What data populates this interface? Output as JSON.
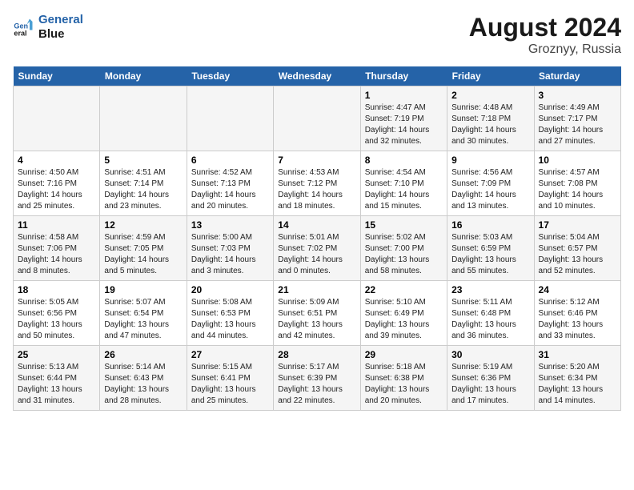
{
  "logo": {
    "line1": "General",
    "line2": "Blue"
  },
  "title": "August 2024",
  "subtitle": "Groznyy, Russia",
  "days_of_week": [
    "Sunday",
    "Monday",
    "Tuesday",
    "Wednesday",
    "Thursday",
    "Friday",
    "Saturday"
  ],
  "weeks": [
    [
      {
        "day": "",
        "info": ""
      },
      {
        "day": "",
        "info": ""
      },
      {
        "day": "",
        "info": ""
      },
      {
        "day": "",
        "info": ""
      },
      {
        "day": "1",
        "info": "Sunrise: 4:47 AM\nSunset: 7:19 PM\nDaylight: 14 hours\nand 32 minutes."
      },
      {
        "day": "2",
        "info": "Sunrise: 4:48 AM\nSunset: 7:18 PM\nDaylight: 14 hours\nand 30 minutes."
      },
      {
        "day": "3",
        "info": "Sunrise: 4:49 AM\nSunset: 7:17 PM\nDaylight: 14 hours\nand 27 minutes."
      }
    ],
    [
      {
        "day": "4",
        "info": "Sunrise: 4:50 AM\nSunset: 7:16 PM\nDaylight: 14 hours\nand 25 minutes."
      },
      {
        "day": "5",
        "info": "Sunrise: 4:51 AM\nSunset: 7:14 PM\nDaylight: 14 hours\nand 23 minutes."
      },
      {
        "day": "6",
        "info": "Sunrise: 4:52 AM\nSunset: 7:13 PM\nDaylight: 14 hours\nand 20 minutes."
      },
      {
        "day": "7",
        "info": "Sunrise: 4:53 AM\nSunset: 7:12 PM\nDaylight: 14 hours\nand 18 minutes."
      },
      {
        "day": "8",
        "info": "Sunrise: 4:54 AM\nSunset: 7:10 PM\nDaylight: 14 hours\nand 15 minutes."
      },
      {
        "day": "9",
        "info": "Sunrise: 4:56 AM\nSunset: 7:09 PM\nDaylight: 14 hours\nand 13 minutes."
      },
      {
        "day": "10",
        "info": "Sunrise: 4:57 AM\nSunset: 7:08 PM\nDaylight: 14 hours\nand 10 minutes."
      }
    ],
    [
      {
        "day": "11",
        "info": "Sunrise: 4:58 AM\nSunset: 7:06 PM\nDaylight: 14 hours\nand 8 minutes."
      },
      {
        "day": "12",
        "info": "Sunrise: 4:59 AM\nSunset: 7:05 PM\nDaylight: 14 hours\nand 5 minutes."
      },
      {
        "day": "13",
        "info": "Sunrise: 5:00 AM\nSunset: 7:03 PM\nDaylight: 14 hours\nand 3 minutes."
      },
      {
        "day": "14",
        "info": "Sunrise: 5:01 AM\nSunset: 7:02 PM\nDaylight: 14 hours\nand 0 minutes."
      },
      {
        "day": "15",
        "info": "Sunrise: 5:02 AM\nSunset: 7:00 PM\nDaylight: 13 hours\nand 58 minutes."
      },
      {
        "day": "16",
        "info": "Sunrise: 5:03 AM\nSunset: 6:59 PM\nDaylight: 13 hours\nand 55 minutes."
      },
      {
        "day": "17",
        "info": "Sunrise: 5:04 AM\nSunset: 6:57 PM\nDaylight: 13 hours\nand 52 minutes."
      }
    ],
    [
      {
        "day": "18",
        "info": "Sunrise: 5:05 AM\nSunset: 6:56 PM\nDaylight: 13 hours\nand 50 minutes."
      },
      {
        "day": "19",
        "info": "Sunrise: 5:07 AM\nSunset: 6:54 PM\nDaylight: 13 hours\nand 47 minutes."
      },
      {
        "day": "20",
        "info": "Sunrise: 5:08 AM\nSunset: 6:53 PM\nDaylight: 13 hours\nand 44 minutes."
      },
      {
        "day": "21",
        "info": "Sunrise: 5:09 AM\nSunset: 6:51 PM\nDaylight: 13 hours\nand 42 minutes."
      },
      {
        "day": "22",
        "info": "Sunrise: 5:10 AM\nSunset: 6:49 PM\nDaylight: 13 hours\nand 39 minutes."
      },
      {
        "day": "23",
        "info": "Sunrise: 5:11 AM\nSunset: 6:48 PM\nDaylight: 13 hours\nand 36 minutes."
      },
      {
        "day": "24",
        "info": "Sunrise: 5:12 AM\nSunset: 6:46 PM\nDaylight: 13 hours\nand 33 minutes."
      }
    ],
    [
      {
        "day": "25",
        "info": "Sunrise: 5:13 AM\nSunset: 6:44 PM\nDaylight: 13 hours\nand 31 minutes."
      },
      {
        "day": "26",
        "info": "Sunrise: 5:14 AM\nSunset: 6:43 PM\nDaylight: 13 hours\nand 28 minutes."
      },
      {
        "day": "27",
        "info": "Sunrise: 5:15 AM\nSunset: 6:41 PM\nDaylight: 13 hours\nand 25 minutes."
      },
      {
        "day": "28",
        "info": "Sunrise: 5:17 AM\nSunset: 6:39 PM\nDaylight: 13 hours\nand 22 minutes."
      },
      {
        "day": "29",
        "info": "Sunrise: 5:18 AM\nSunset: 6:38 PM\nDaylight: 13 hours\nand 20 minutes."
      },
      {
        "day": "30",
        "info": "Sunrise: 5:19 AM\nSunset: 6:36 PM\nDaylight: 13 hours\nand 17 minutes."
      },
      {
        "day": "31",
        "info": "Sunrise: 5:20 AM\nSunset: 6:34 PM\nDaylight: 13 hours\nand 14 minutes."
      }
    ]
  ]
}
